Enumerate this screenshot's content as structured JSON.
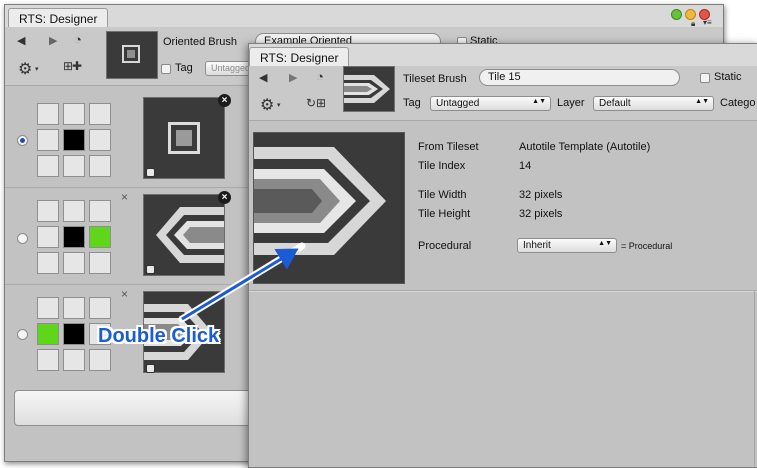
{
  "back_window": {
    "tab_title": "RTS: Designer",
    "brush_type_label": "Oriented Brush",
    "brush_name_value": "Example Oriented",
    "static_label": "Static",
    "tag_label": "Tag",
    "tag_value": "Untagged",
    "orientations": [
      {
        "selected": true,
        "pattern": [
          "empty",
          "empty",
          "empty",
          "empty",
          "black",
          "empty",
          "empty",
          "empty",
          "empty"
        ]
      },
      {
        "selected": false,
        "pattern": [
          "empty",
          "empty",
          "empty",
          "empty",
          "black",
          "green",
          "empty",
          "empty",
          "empty"
        ]
      },
      {
        "selected": false,
        "pattern": [
          "empty",
          "empty",
          "empty",
          "green",
          "black",
          "empty",
          "empty",
          "empty",
          "empty"
        ]
      }
    ],
    "close_glyph": "×",
    "icons": [
      "back-arrow-icon",
      "forward-arrow-icon",
      "history-icon",
      "gear-icon",
      "grid-add-icon"
    ]
  },
  "front_window": {
    "tab_title": "RTS: Designer",
    "brush_type_label": "Tileset Brush",
    "brush_name_value": "Tile 15",
    "static_label": "Static",
    "tag_label": "Tag",
    "tag_value": "Untagged",
    "layer_label": "Layer",
    "layer_value": "Default",
    "category_label": "Catego",
    "info": {
      "from_tileset_label": "From Tileset",
      "from_tileset_value": "Autotile Template (Autotile)",
      "tile_index_label": "Tile Index",
      "tile_index_value": "14",
      "tile_width_label": "Tile Width",
      "tile_width_value": "32 pixels",
      "tile_height_label": "Tile Height",
      "tile_height_value": "32 pixels",
      "procedural_label": "Procedural",
      "procedural_value": "Inherit",
      "procedural_result": "= Procedural"
    }
  },
  "annotation": {
    "text": "Double Click",
    "color": "#1a5cd6"
  },
  "colors": {
    "panel": "#c2c2c2",
    "tile_dark": "#3a3a3a",
    "green": "#5fd61a"
  }
}
